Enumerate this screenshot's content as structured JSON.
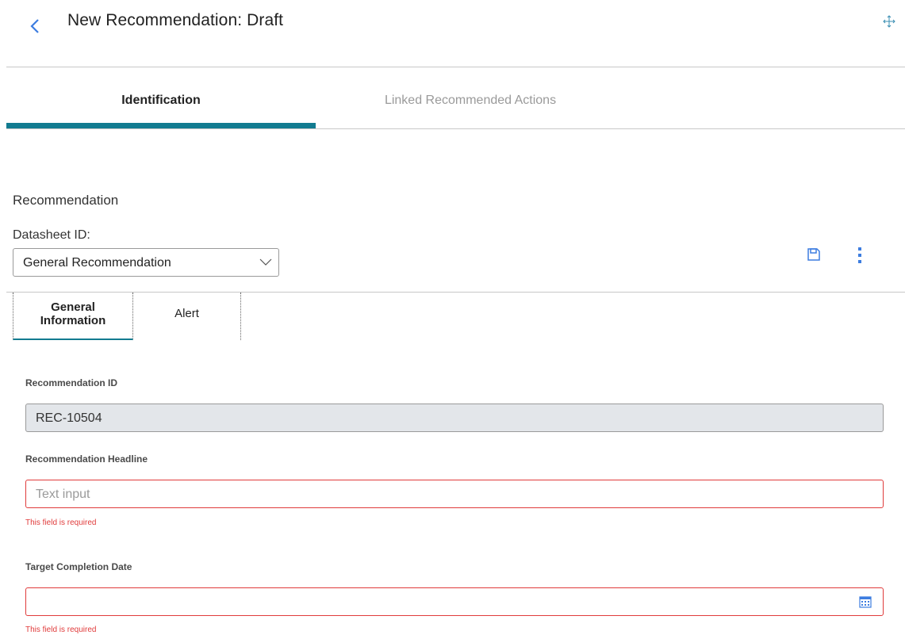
{
  "header": {
    "title": "New Recommendation: Draft",
    "back_icon": "chevron-left-icon",
    "move_icon": "move-arrows-icon"
  },
  "tabs": [
    {
      "label": "Identification",
      "active": true
    },
    {
      "label": "Linked Recommended Actions",
      "active": false
    }
  ],
  "section": {
    "title": "Recommendation",
    "datasheet_label": "Datasheet ID:",
    "datasheet_value": "General Recommendation"
  },
  "toolbar": {
    "save_icon": "save-icon",
    "more_icon": "kebab-menu-icon"
  },
  "subtabs": [
    {
      "label_line1": "General",
      "label_line2": "Information",
      "active": true
    },
    {
      "label": "Alert",
      "active": false
    }
  ],
  "fields": {
    "rec_id": {
      "label": "Recommendation ID",
      "value": "REC-10504"
    },
    "headline": {
      "label": "Recommendation Headline",
      "placeholder": "Text input",
      "error": "This field is required"
    },
    "target_date": {
      "label": "Target Completion Date",
      "value": "",
      "error": "This field is required"
    }
  },
  "colors": {
    "accent": "#127b90",
    "error": "#e03b3b",
    "back_icon": "#3d7de0"
  }
}
